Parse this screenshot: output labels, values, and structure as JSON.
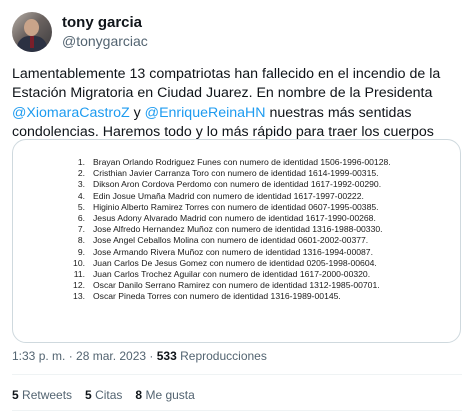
{
  "author": {
    "name": "tony garcia",
    "handle": "@tonygarciac"
  },
  "tweet": {
    "text_part1": "Lamentablemente 13 compatriotas han fallecido en el incendio de la Estación Migratoria en Ciudad Juarez. En nombre de la Presidenta ",
    "mention1": "@XiomaraCastroZ",
    "text_part2": "  y ",
    "mention2": "@EnriqueReinaHN",
    "text_part3": " nuestras más sentidas condolencias. Haremos todo y lo más rápido para traer los cuerpos"
  },
  "document": {
    "items": [
      {
        "num": "1.",
        "text": "Brayan Orlando Rodriguez Funes con numero de identidad 1506-1996-00128."
      },
      {
        "num": "2.",
        "text": "Cristhian Javier Carranza Toro con numero de identidad 1614-1999-00315."
      },
      {
        "num": "3.",
        "text": "Dikson Aron Cordova Perdomo con numero de identidad 1617-1992-00290."
      },
      {
        "num": "4.",
        "text": "Edin Josue Umaña Madrid con numero de identidad 1617-1997-00222."
      },
      {
        "num": "5.",
        "text": "Higinio Alberto Ramirez Torres con numero de identidad 0607-1995-00385."
      },
      {
        "num": "6.",
        "text": "Jesus Adony Alvarado Madrid con numero de identidad 1617-1990-00268."
      },
      {
        "num": "7.",
        "text": "Jose Alfredo Hernandez Muñoz con numero de identidad 1316-1988-00330."
      },
      {
        "num": "8.",
        "text": "Jose Angel Ceballos Molina con numero de identidad 0601-2002-00377."
      },
      {
        "num": "9.",
        "text": "Jose Armando Rivera Muñoz con numero de identidad 1316-1994-00087."
      },
      {
        "num": "10.",
        "text": "Juan Carlos De Jesus Gomez con numero de identidad 0205-1998-00604."
      },
      {
        "num": "11.",
        "text": "Juan Carlos Trochez Aguilar con numero de identidad 1617-2000-00320."
      },
      {
        "num": "12.",
        "text": "Oscar Danilo Serrano Ramirez con numero de identidad 1312-1985-00701."
      },
      {
        "num": "13.",
        "text": "Oscar Pineda Torres con numero de identidad 1316-1989-00145."
      }
    ]
  },
  "meta": {
    "timestamp": "1:33 p. m. · 28 mar. 2023 · ",
    "views_count": "533",
    "views_label": " Reproducciones"
  },
  "stats": {
    "retweets_count": "5",
    "retweets_label": " Retweets",
    "quotes_count": "5",
    "quotes_label": " Citas",
    "likes_count": "8",
    "likes_label": " Me gusta"
  }
}
